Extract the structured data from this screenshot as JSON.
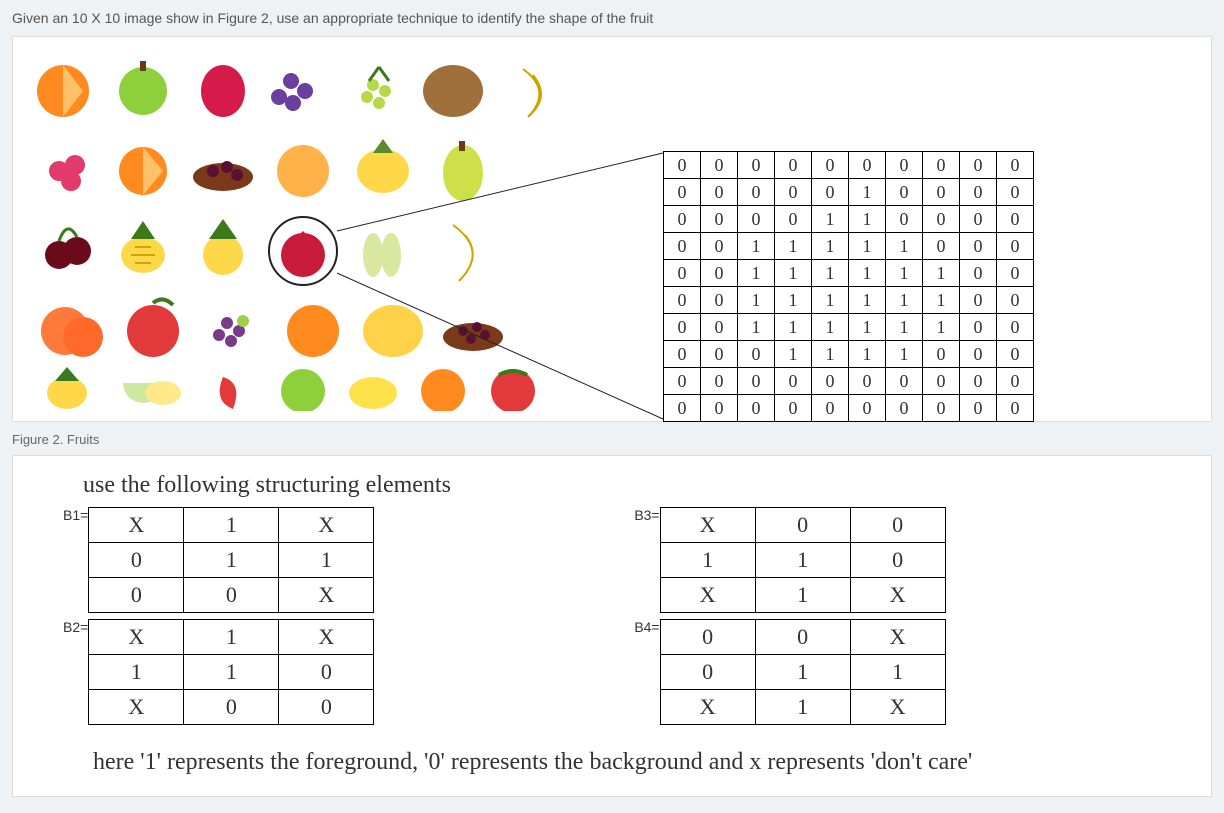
{
  "question": "Given an 10 X 10 image show in Figure 2, use an appropriate technique to identify the shape of the fruit",
  "figure_caption": "Figure 2. Fruits",
  "image_matrix": [
    [
      0,
      0,
      0,
      0,
      0,
      0,
      0,
      0,
      0,
      0
    ],
    [
      0,
      0,
      0,
      0,
      0,
      1,
      0,
      0,
      0,
      0
    ],
    [
      0,
      0,
      0,
      0,
      1,
      1,
      0,
      0,
      0,
      0
    ],
    [
      0,
      0,
      1,
      1,
      1,
      1,
      1,
      0,
      0,
      0
    ],
    [
      0,
      0,
      1,
      1,
      1,
      1,
      1,
      1,
      0,
      0
    ],
    [
      0,
      0,
      1,
      1,
      1,
      1,
      1,
      1,
      0,
      0
    ],
    [
      0,
      0,
      1,
      1,
      1,
      1,
      1,
      1,
      0,
      0
    ],
    [
      0,
      0,
      0,
      1,
      1,
      1,
      1,
      0,
      0,
      0
    ],
    [
      0,
      0,
      0,
      0,
      0,
      0,
      0,
      0,
      0,
      0
    ],
    [
      0,
      0,
      0,
      0,
      0,
      0,
      0,
      0,
      0,
      0
    ]
  ],
  "se_intro": "use the following structuring elements",
  "se_labels": {
    "b1": "B1=",
    "b2": "B2=",
    "b3": "B3=",
    "b4": "B4="
  },
  "se": {
    "b1": [
      [
        "X",
        "1",
        "X"
      ],
      [
        "0",
        "1",
        "1"
      ],
      [
        "0",
        "0",
        "X"
      ]
    ],
    "b2": [
      [
        "X",
        "1",
        "X"
      ],
      [
        "1",
        "1",
        "0"
      ],
      [
        "X",
        "0",
        "0"
      ]
    ],
    "b3": [
      [
        "X",
        "0",
        "0"
      ],
      [
        "1",
        "1",
        "0"
      ],
      [
        "X",
        "1",
        "X"
      ]
    ],
    "b4": [
      [
        "0",
        "0",
        "X"
      ],
      [
        "0",
        "1",
        "1"
      ],
      [
        "X",
        "1",
        "X"
      ]
    ]
  },
  "se_note": "here '1' represents the foreground, '0' represents the background and x represents 'don't care'"
}
